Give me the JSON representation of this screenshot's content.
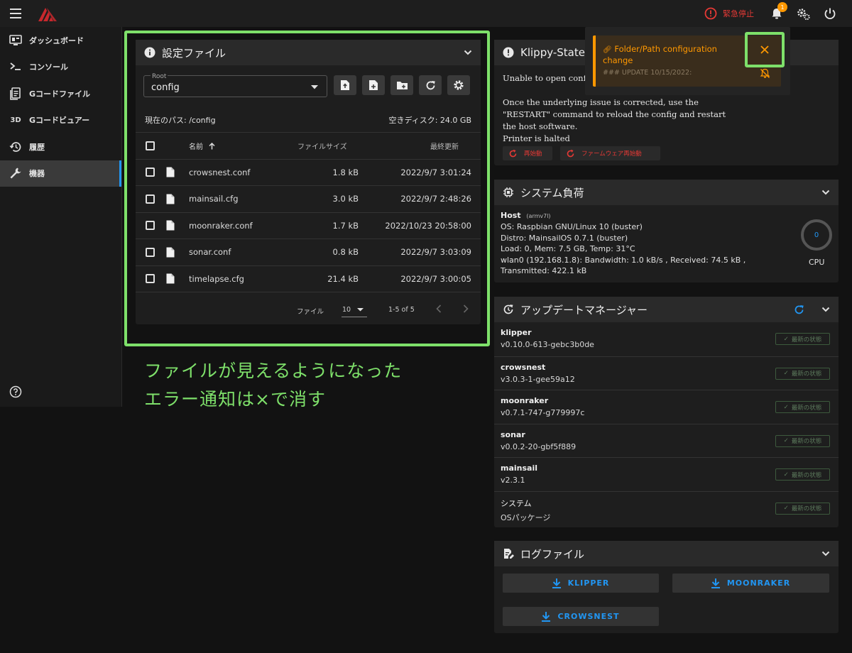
{
  "topbar": {
    "estop_label": "緊急停止",
    "notif_count": "1"
  },
  "sidebar": {
    "items": [
      {
        "label": "ダッシュボード",
        "icon": "monitor-dashboard-icon"
      },
      {
        "label": "コンソール",
        "icon": "console-icon"
      },
      {
        "label": "Gコードファイル",
        "icon": "file-document-icon"
      },
      {
        "label": "Gコードビュアー",
        "icon": "3d-icon",
        "icon_text": "3D"
      },
      {
        "label": "履歴",
        "icon": "history-icon"
      },
      {
        "label": "機器",
        "icon": "wrench-icon"
      }
    ]
  },
  "files": {
    "title": "設定ファイル",
    "root_label": "Root",
    "root_value": "config",
    "path_label": "現在のパス: /config",
    "free_label": "空きディスク: 24.0 GB",
    "cols": {
      "name": "名前",
      "size": "ファイルサイズ",
      "modified": "最終更新"
    },
    "rows": [
      {
        "name": "crowsnest.conf",
        "size": "1.8 kB",
        "date": "2022/9/7 3:01:24"
      },
      {
        "name": "mainsail.cfg",
        "size": "3.0 kB",
        "date": "2022/9/7 2:48:26"
      },
      {
        "name": "moonraker.conf",
        "size": "1.7 kB",
        "date": "2022/10/23 20:58:00"
      },
      {
        "name": "sonar.conf",
        "size": "0.8 kB",
        "date": "2022/9/7 3:03:09"
      },
      {
        "name": "timelapse.cfg",
        "size": "21.4 kB",
        "date": "2022/9/7 3:00:05"
      }
    ],
    "footer": {
      "per_page_label": "ファイル",
      "per_page": "10",
      "range": "1-5 of 5"
    }
  },
  "annotation": {
    "line1": "ファイルが見えるようになった",
    "line2": "エラー通知は×で消す",
    "color": "#7ee06a"
  },
  "notification": {
    "title": "Folder/Path configuration change",
    "body": "### UPDATE 10/15/2022:"
  },
  "klippy": {
    "title": "Klippy-State: ",
    "msg1": "Unable to open config",
    "msg2": "Once the underlying issue is corrected, use the \"RESTART\" command to reload the config and restart the host software.",
    "msg3": "Printer is halted",
    "restart_label": "再始動",
    "fw_restart_label": "ファームウェア再始動"
  },
  "system": {
    "title": "システム負荷",
    "host_label": "Host",
    "host_arch": "(armv7l)",
    "lines": [
      "OS: Raspbian GNU/Linux 10 (buster)",
      "Distro: MainsailOS 0.7.1 (buster)",
      "Load: 0, Mem: 7.5 GB, Temp: 31°C",
      "wlan0 (192.168.1.8): Bandwidth: 1.0 kB/s , Received: 74.5 kB ,",
      "Transmitted: 422.1 kB"
    ],
    "cpu_value": "0",
    "cpu_label": "CPU"
  },
  "updates": {
    "title": "アップデートマネージャー",
    "items": [
      {
        "name": "klipper",
        "version": "v0.10.0-613-gebc3b0de",
        "status": "最新の状態"
      },
      {
        "name": "crowsnest",
        "version": "v3.0.3-1-gee59a12",
        "status": "最新の状態"
      },
      {
        "name": "moonraker",
        "version": "v0.7.1-747-g779997c",
        "status": "最新の状態"
      },
      {
        "name": "sonar",
        "version": "v0.0.2-20-gbf5f889",
        "status": "最新の状態"
      },
      {
        "name": "mainsail",
        "version": "v2.3.1",
        "status": "最新の状態"
      },
      {
        "name": "システム",
        "version": "OSパッケージ",
        "status": "最新の状態"
      }
    ]
  },
  "logs": {
    "title": "ログファイル",
    "buttons": [
      "KLIPPER",
      "MOONRAKER",
      "CROWSNEST"
    ]
  }
}
